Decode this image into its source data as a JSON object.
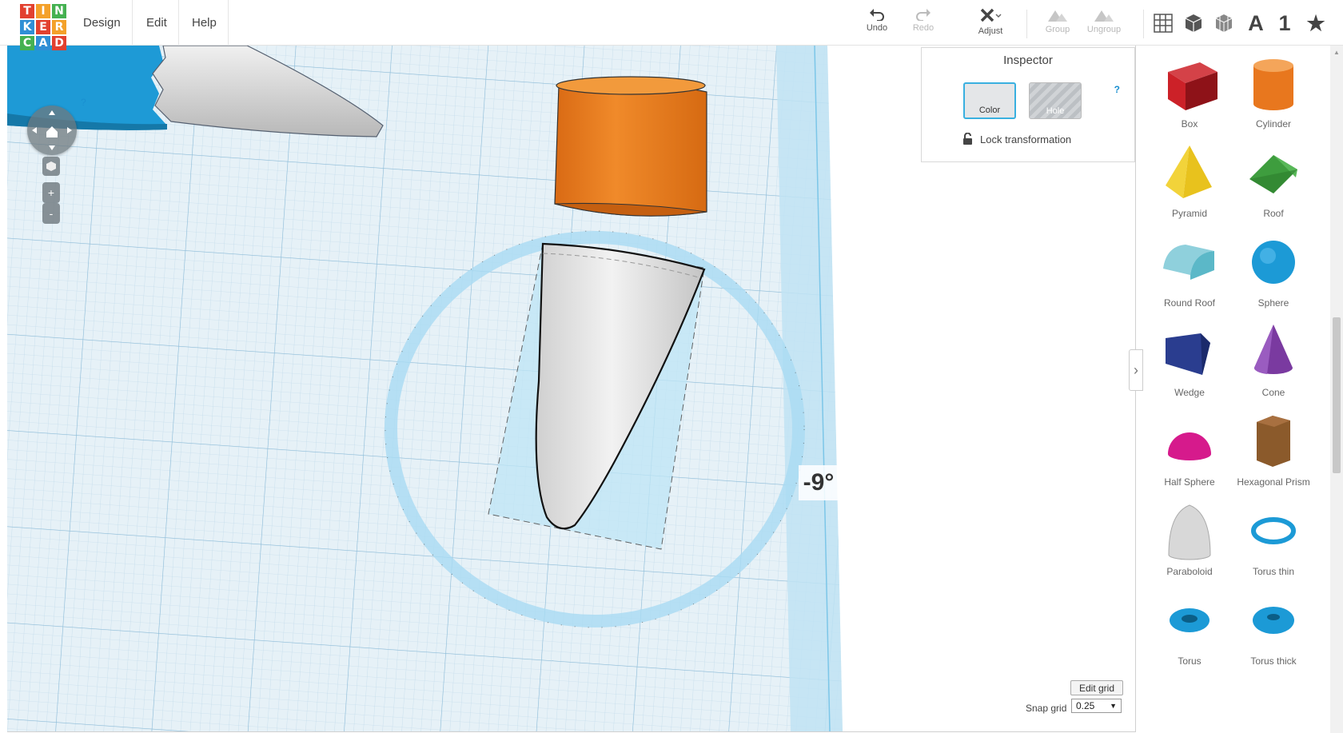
{
  "logo": {
    "letters": [
      "T",
      "I",
      "N",
      "K",
      "E",
      "R",
      "C",
      "A",
      "D"
    ],
    "colors": [
      "#e2412f",
      "#f4a12a",
      "#45b151",
      "#2f8fd5",
      "#e2412f",
      "#f4a12a",
      "#45b151",
      "#2f8fd5",
      "#e2412f"
    ]
  },
  "menu": {
    "design": "Design",
    "edit": "Edit",
    "help": "Help"
  },
  "toolbar": {
    "undo": "Undo",
    "redo": "Redo",
    "adjust": "Adjust",
    "group": "Group",
    "ungroup": "Ungroup"
  },
  "views": {
    "text_view": "A",
    "number_view": "1"
  },
  "inspector": {
    "title": "Inspector",
    "color_label": "Color",
    "hole_label": "Hole",
    "help": "?",
    "lock_label": "Lock transformation"
  },
  "workplane": {
    "rotation_readout": "-9°",
    "help": "?"
  },
  "nav": {
    "zoom_in": "+",
    "zoom_out": "-"
  },
  "shapes": [
    {
      "label": "Box",
      "color": "#cc2128"
    },
    {
      "label": "Cylinder",
      "color": "#e8771e"
    },
    {
      "label": "Pyramid",
      "color": "#e8c21d"
    },
    {
      "label": "Roof",
      "color": "#3e9d3e"
    },
    {
      "label": "Round Roof",
      "color": "#5bb8c8"
    },
    {
      "label": "Sphere",
      "color": "#1c9ad6"
    },
    {
      "label": "Wedge",
      "color": "#2a3d8f"
    },
    {
      "label": "Cone",
      "color": "#7a3aa0"
    },
    {
      "label": "Half Sphere",
      "color": "#d61a8c"
    },
    {
      "label": "Hexagonal Prism",
      "color": "#8b5a2b"
    },
    {
      "label": "Paraboloid",
      "color": "#d8d8d8"
    },
    {
      "label": "Torus thin",
      "color": "#1c9ad6"
    },
    {
      "label": "Torus",
      "color": "#1c9ad6"
    },
    {
      "label": "Torus thick",
      "color": "#1c9ad6"
    }
  ],
  "grid": {
    "edit_label": "Edit grid",
    "snap_label": "Snap grid",
    "snap_value": "0.25"
  }
}
